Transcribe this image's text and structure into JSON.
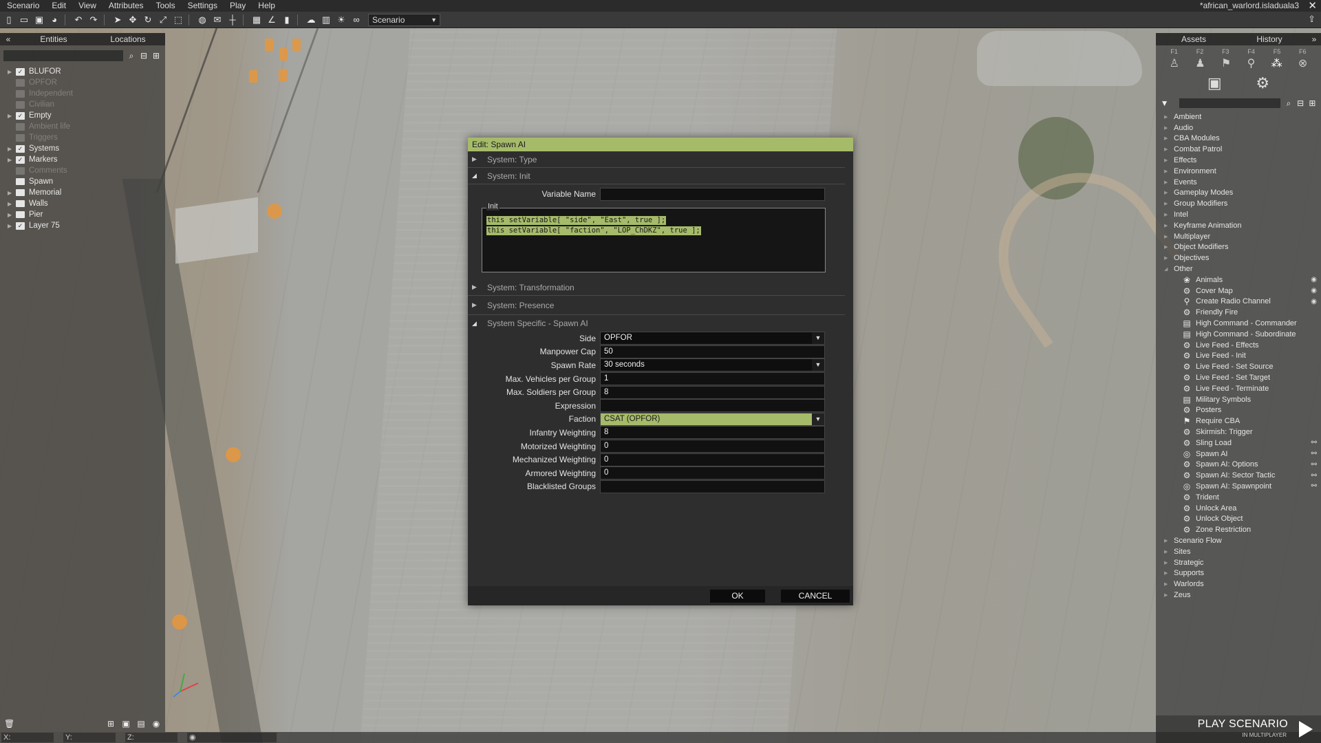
{
  "menubar": {
    "items": [
      "Scenario",
      "Edit",
      "View",
      "Attributes",
      "Tools",
      "Settings",
      "Play",
      "Help"
    ],
    "window_title": "*african_warlord.isladuala3",
    "close_glyph": "✕"
  },
  "toolbar": {
    "mode_value": "Scenario",
    "icons": [
      "new-icon",
      "open-icon",
      "save-icon",
      "publish-icon",
      "undo-icon",
      "redo-icon",
      "select-icon",
      "translate-icon",
      "rotate-icon",
      "scale-icon",
      "area-icon",
      "globe-icon",
      "map-icon",
      "vertical-icon",
      "grid-icon",
      "angle-icon",
      "snap-icon",
      "weather-icon",
      "city-icon",
      "light-icon",
      "binoculars-icon"
    ]
  },
  "left_panel": {
    "collapse_glyph": "«",
    "tabs": [
      "Entities",
      "Locations"
    ],
    "tree": [
      {
        "label": "BLUFOR",
        "type": "box",
        "dim": false,
        "arrow": true
      },
      {
        "label": "OPFOR",
        "type": "box",
        "dim": true,
        "arrow": false
      },
      {
        "label": "Independent",
        "type": "box",
        "dim": true,
        "arrow": false
      },
      {
        "label": "Civilian",
        "type": "box",
        "dim": true,
        "arrow": false
      },
      {
        "label": "Empty",
        "type": "box",
        "dim": false,
        "arrow": true
      },
      {
        "label": "Ambient life",
        "type": "box",
        "dim": true,
        "arrow": false
      },
      {
        "label": "Triggers",
        "type": "box",
        "dim": true,
        "arrow": false
      },
      {
        "label": "Systems",
        "type": "box",
        "dim": false,
        "arrow": true
      },
      {
        "label": "Markers",
        "type": "box",
        "dim": false,
        "arrow": true
      },
      {
        "label": "Comments",
        "type": "box",
        "dim": true,
        "arrow": false
      },
      {
        "label": "Spawn",
        "type": "folder",
        "dim": false,
        "arrow": false
      },
      {
        "label": "Memorial",
        "type": "folder",
        "dim": false,
        "arrow": true
      },
      {
        "label": "Walls",
        "type": "folder",
        "dim": false,
        "arrow": true
      },
      {
        "label": "Pier",
        "type": "folder",
        "dim": false,
        "arrow": true
      },
      {
        "label": "Layer 75",
        "type": "box",
        "dim": false,
        "arrow": true
      }
    ]
  },
  "statusbar": {
    "x_label": "X:",
    "y_label": "Y:",
    "z_label": "Z:"
  },
  "dialog": {
    "title": "Edit: Spawn AI",
    "sections": {
      "type": "System: Type",
      "init": "System: Init",
      "transformation": "System: Transformation",
      "presence": "System: Presence",
      "specific": "System Specific - Spawn AI"
    },
    "variable_name": {
      "label": "Variable Name",
      "value": ""
    },
    "init": {
      "legend": "Init",
      "lines": [
        "this setVariable[ \"side\", \"East\", true ];",
        "this setVariable[ \"faction\", \"LOP_ChDKZ\", true ];"
      ]
    },
    "fields": [
      {
        "label": "Side",
        "value": "OPFOR",
        "kind": "select"
      },
      {
        "label": "Manpower Cap",
        "value": "50",
        "kind": "text"
      },
      {
        "label": "Spawn Rate",
        "value": "30 seconds",
        "kind": "select"
      },
      {
        "label": "Max. Vehicles per Group",
        "value": "1",
        "kind": "text"
      },
      {
        "label": "Max. Soldiers per Group",
        "value": "8",
        "kind": "text"
      },
      {
        "label": "Expression",
        "value": "",
        "kind": "text"
      },
      {
        "label": "Faction",
        "value": "CSAT (OPFOR)",
        "kind": "select-hl"
      },
      {
        "label": "Infantry Weighting",
        "value": "8",
        "kind": "text"
      },
      {
        "label": "Motorized Weighting",
        "value": "0",
        "kind": "text"
      },
      {
        "label": "Mechanized Weighting",
        "value": "0",
        "kind": "text"
      },
      {
        "label": "Armored Weighting",
        "value": "0",
        "kind": "text"
      },
      {
        "label": "Blacklisted Groups",
        "value": "",
        "kind": "text"
      }
    ],
    "ok_label": "OK",
    "cancel_label": "CANCEL"
  },
  "right_panel": {
    "tabs": [
      "Assets",
      "History"
    ],
    "expand_glyph": "»",
    "fkeys": [
      "F1",
      "F2",
      "F3",
      "F4",
      "F5",
      "F6"
    ],
    "categories_top": [
      {
        "label": "Ambient"
      },
      {
        "label": "Audio"
      },
      {
        "label": "CBA Modules"
      },
      {
        "label": "Combat Patrol"
      },
      {
        "label": "Effects"
      },
      {
        "label": "Environment"
      },
      {
        "label": "Events"
      },
      {
        "label": "Gameplay Modes"
      },
      {
        "label": "Group Modifiers"
      },
      {
        "label": "Intel"
      },
      {
        "label": "Keyframe Animation"
      },
      {
        "label": "Multiplayer"
      },
      {
        "label": "Object Modifiers"
      },
      {
        "label": "Objectives"
      },
      {
        "label": "Other"
      }
    ],
    "other_items": [
      {
        "label": "Animals",
        "icon": "paw-icon",
        "trail": "eye"
      },
      {
        "label": "Cover Map",
        "icon": "gear-icon",
        "trail": "eye"
      },
      {
        "label": "Create Radio Channel",
        "icon": "radio-icon",
        "trail": "eye"
      },
      {
        "label": "Friendly Fire",
        "icon": "gear-icon",
        "trail": ""
      },
      {
        "label": "High Command - Commander",
        "icon": "doc-icon",
        "trail": ""
      },
      {
        "label": "High Command - Subordinate",
        "icon": "doc-icon",
        "trail": ""
      },
      {
        "label": "Live Feed - Effects",
        "icon": "gear-icon",
        "trail": ""
      },
      {
        "label": "Live Feed - Init",
        "icon": "gear-icon",
        "trail": ""
      },
      {
        "label": "Live Feed - Set Source",
        "icon": "gear-icon",
        "trail": ""
      },
      {
        "label": "Live Feed - Set Target",
        "icon": "gear-icon",
        "trail": ""
      },
      {
        "label": "Live Feed - Terminate",
        "icon": "gear-icon",
        "trail": ""
      },
      {
        "label": "Military Symbols",
        "icon": "doc-icon",
        "trail": ""
      },
      {
        "label": "Posters",
        "icon": "gear-icon",
        "trail": ""
      },
      {
        "label": "Require CBA",
        "icon": "flag-icon",
        "trail": ""
      },
      {
        "label": "Skirmish: Trigger",
        "icon": "gear-icon",
        "trail": ""
      },
      {
        "label": "Sling Load",
        "icon": "gear-icon",
        "trail": "link"
      },
      {
        "label": "Spawn AI",
        "icon": "target-icon",
        "trail": "link"
      },
      {
        "label": "Spawn AI: Options",
        "icon": "gear-icon",
        "trail": "link"
      },
      {
        "label": "Spawn AI: Sector Tactic",
        "icon": "gear-icon",
        "trail": "link"
      },
      {
        "label": "Spawn AI: Spawnpoint",
        "icon": "target-icon",
        "trail": "link"
      },
      {
        "label": "Trident",
        "icon": "gear-icon",
        "trail": ""
      },
      {
        "label": "Unlock Area",
        "icon": "gear-icon",
        "trail": ""
      },
      {
        "label": "Unlock Object",
        "icon": "gear-icon",
        "trail": ""
      },
      {
        "label": "Zone Restriction",
        "icon": "gear-icon",
        "trail": ""
      }
    ],
    "categories_bottom": [
      {
        "label": "Scenario Flow"
      },
      {
        "label": "Sites"
      },
      {
        "label": "Strategic"
      },
      {
        "label": "Supports"
      },
      {
        "label": "Warlords"
      },
      {
        "label": "Zeus"
      }
    ],
    "play_label": "PLAY SCENARIO",
    "play_sub": "IN MULTIPLAYER"
  }
}
